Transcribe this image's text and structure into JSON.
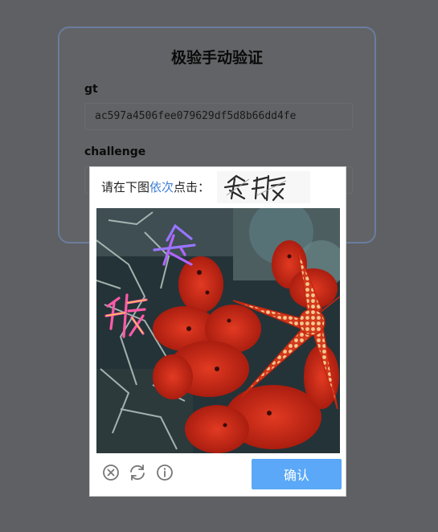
{
  "page": {
    "title": "极验手动验证",
    "fields": [
      {
        "label": "gt",
        "value": "ac597a4506fee079629df5d8b66dd4fe"
      },
      {
        "label": "challenge",
        "value": ""
      }
    ]
  },
  "captcha": {
    "prompt_prefix": "请在下图",
    "prompt_highlight": "依次",
    "prompt_suffix": "点击：",
    "target_glyphs": "冬 旗",
    "confirm_label": "确认",
    "icons": [
      "close-icon",
      "refresh-icon",
      "info-icon"
    ],
    "colors": {
      "highlight": "#3d7fd6",
      "confirm": "#5aa8f7"
    }
  }
}
